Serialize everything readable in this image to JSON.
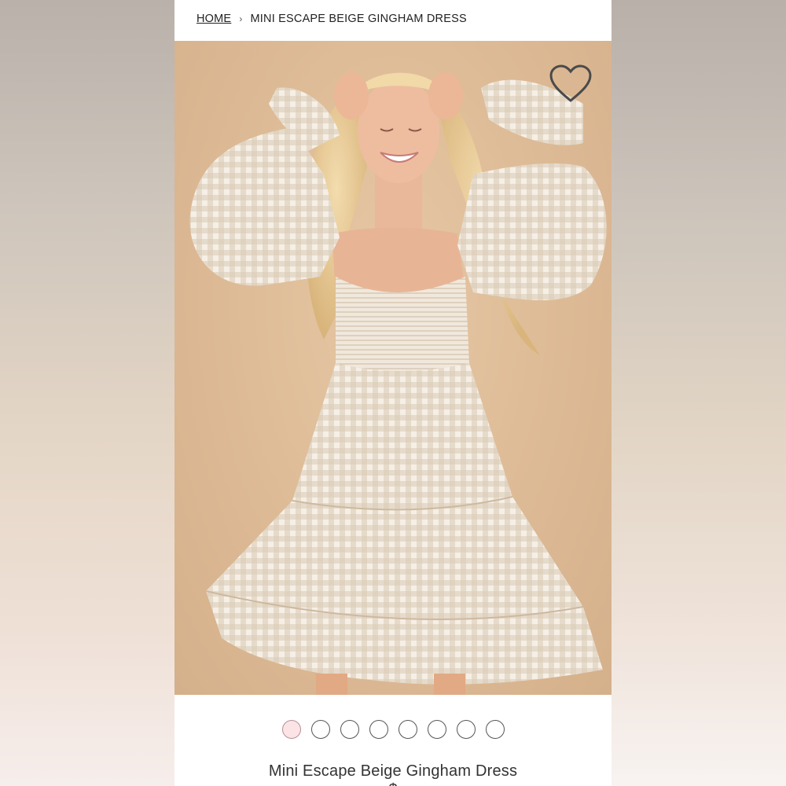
{
  "breadcrumb": {
    "home_label": "HOME",
    "separator": "›",
    "current_label": "MINI ESCAPE BEIGE GINGHAM DRESS"
  },
  "product": {
    "image_alt": "Model wearing a beige gingham mini dress with puff sleeves",
    "title": "Mini Escape Beige Gingham Dress",
    "price": "$"
  },
  "carousel": {
    "total": 8,
    "active_index": 0
  },
  "icons": {
    "wishlist": "heart-outline-icon"
  },
  "colors": {
    "photo_background": "#dcb994",
    "active_dot": "#fbe3e6",
    "gingham": "#d9c9b4"
  }
}
